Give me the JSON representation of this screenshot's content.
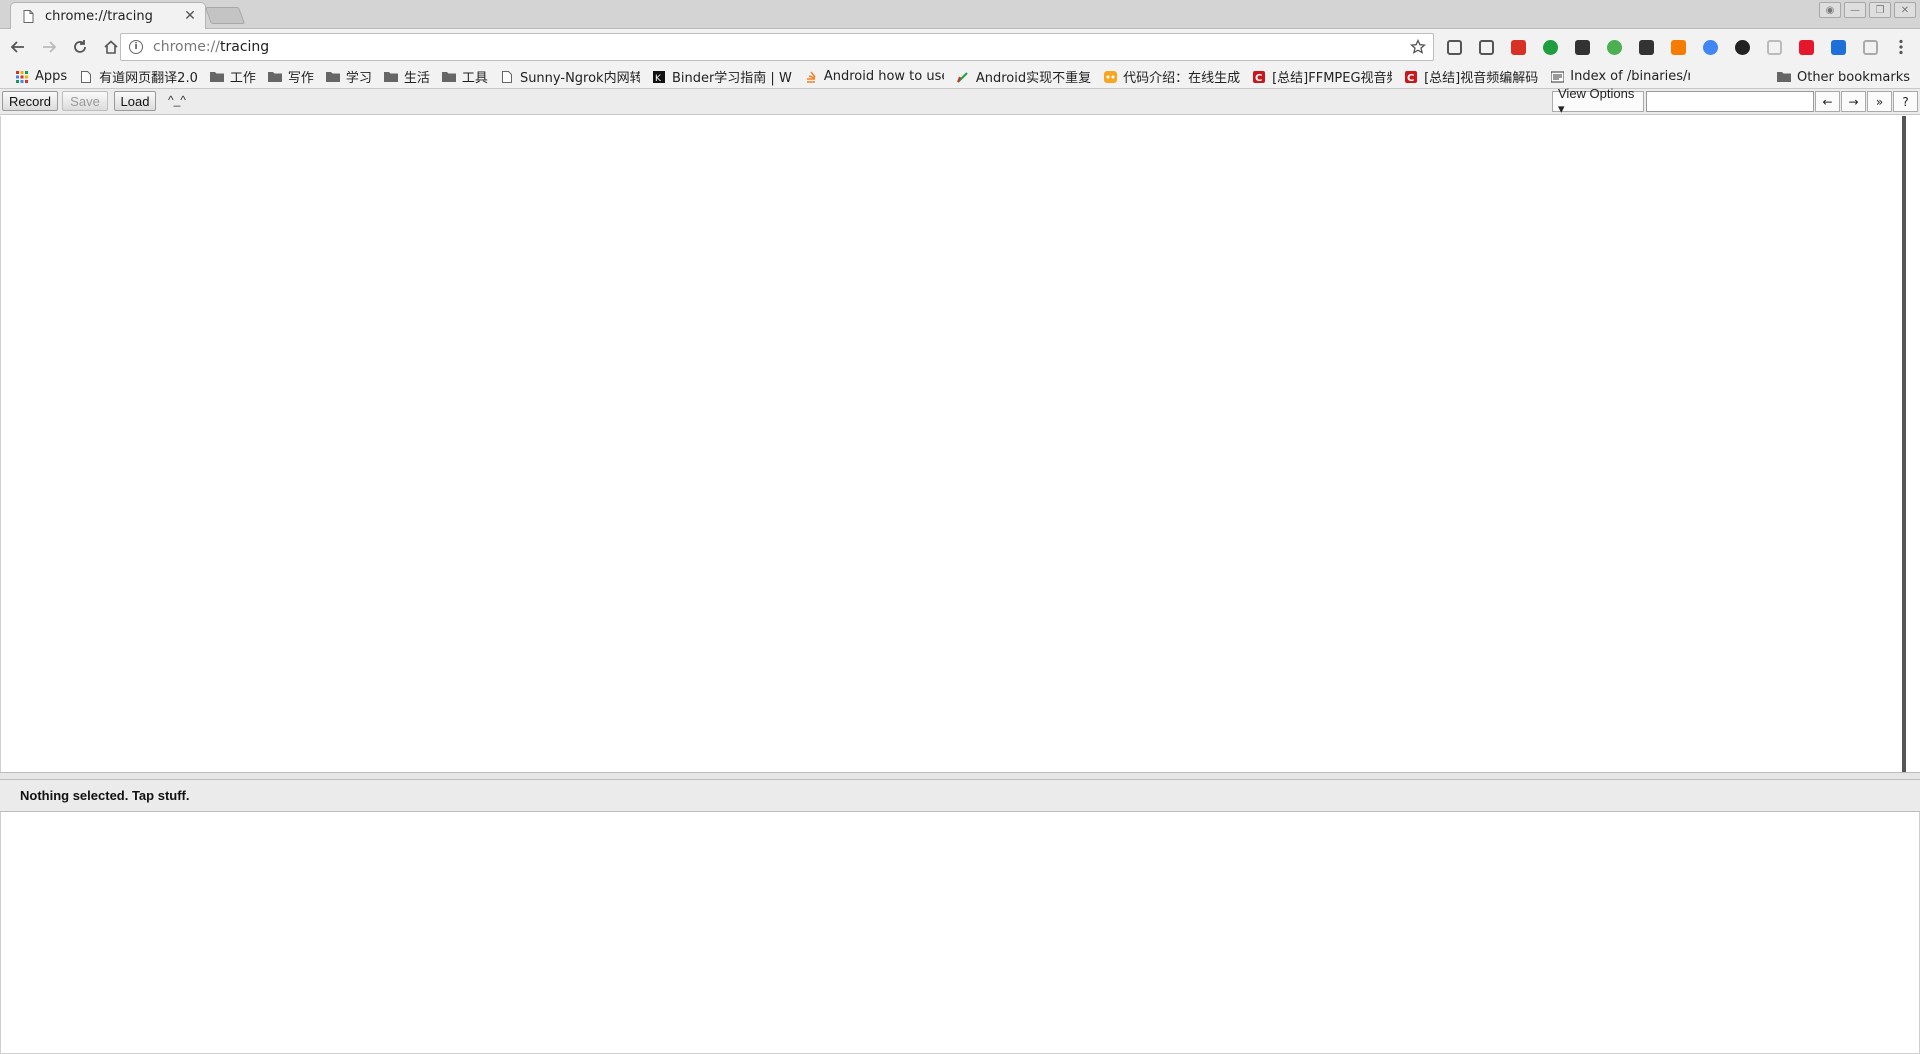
{
  "browser": {
    "tab_title": "chrome://tracing",
    "url_scheme": "chrome://",
    "url_host": "tracing"
  },
  "extensions": [
    {
      "name": "pocket-icon",
      "color": "#555555"
    },
    {
      "name": "mail-icon",
      "color": "#555555"
    },
    {
      "name": "red-ext-icon",
      "color": "#d93025"
    },
    {
      "name": "green-circle-icon",
      "color": "#1e9e3e"
    },
    {
      "name": "x-ext-icon",
      "color": "#333333"
    },
    {
      "name": "green-dot-icon",
      "color": "#4caf50"
    },
    {
      "name": "chart-icon",
      "color": "#333333"
    },
    {
      "name": "orange-x-icon",
      "color": "#f57c00"
    },
    {
      "name": "google-icon",
      "color": "#4285f4"
    },
    {
      "name": "dark-circle-icon",
      "color": "#222222"
    },
    {
      "name": "book-icon",
      "color": "#bbbbbb"
    },
    {
      "name": "weibo-icon",
      "color": "#e6162d"
    },
    {
      "name": "translate-icon",
      "color": "#1e6fd9"
    },
    {
      "name": "search-ext-icon",
      "color": "#aaaaaa"
    }
  ],
  "bookmarks": [
    {
      "label": "Apps",
      "icon": "apps-icon"
    },
    {
      "label": "有道网页翻译2.0",
      "icon": "page-icon"
    },
    {
      "label": "工作",
      "icon": "folder-icon"
    },
    {
      "label": "写作",
      "icon": "folder-icon"
    },
    {
      "label": "学习",
      "icon": "folder-icon"
    },
    {
      "label": "生活",
      "icon": "folder-icon"
    },
    {
      "label": "工具",
      "icon": "folder-icon"
    },
    {
      "label": "Sunny-Ngrok内网转",
      "icon": "page-icon"
    },
    {
      "label": "Binder学习指南 | W",
      "icon": "binder-icon"
    },
    {
      "label": "Android how to use",
      "icon": "stack-icon"
    },
    {
      "label": "Android实现不重复",
      "icon": "pen-icon"
    },
    {
      "label": "代码介绍：在线生成",
      "icon": "orange-icon"
    },
    {
      "label": "[总结]FFMPEG视音频",
      "icon": "csdn-icon"
    },
    {
      "label": "[总结]视音频编解码",
      "icon": "csdn-icon"
    },
    {
      "label": "Index of /binaries/m",
      "icon": "index-icon"
    }
  ],
  "other_bookmarks": "Other bookmarks",
  "tracing": {
    "record_label": "Record",
    "save_label": "Save",
    "load_label": "Load",
    "face": "^_^",
    "view_options_label": "View Options ▾",
    "search_placeholder": "",
    "prev_label": "←",
    "next_label": "→",
    "more_label": "»",
    "help_label": "?"
  },
  "analysis": {
    "message": "Nothing selected. Tap stuff."
  }
}
